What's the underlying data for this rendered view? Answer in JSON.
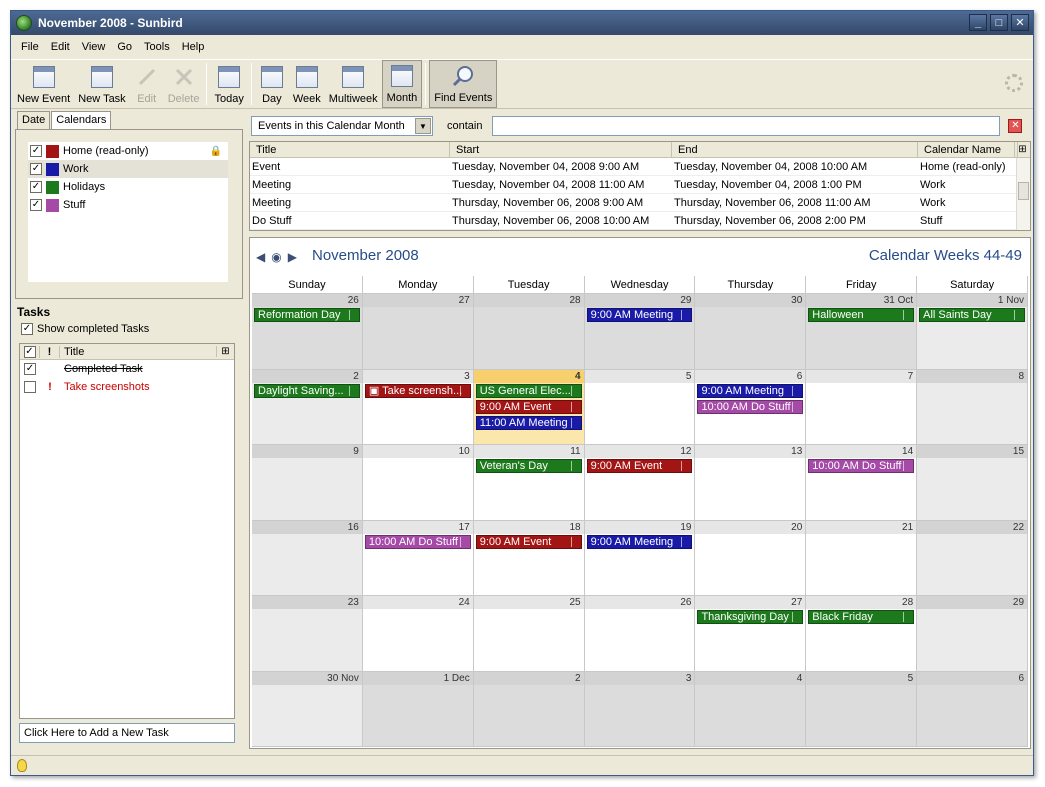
{
  "window": {
    "title": "November 2008 - Sunbird"
  },
  "menu": [
    "File",
    "Edit",
    "View",
    "Go",
    "Tools",
    "Help"
  ],
  "toolbar": {
    "new_event": "New Event",
    "new_task": "New Task",
    "edit": "Edit",
    "delete": "Delete",
    "today": "Today",
    "day": "Day",
    "week": "Week",
    "multiweek": "Multiweek",
    "month": "Month",
    "find_events": "Find Events"
  },
  "left": {
    "tabs": [
      "Date",
      "Calendars"
    ],
    "calendars": [
      {
        "name": "Home (read-only)",
        "color": "#a31414",
        "locked": true
      },
      {
        "name": "Work",
        "color": "#1a1aa8"
      },
      {
        "name": "Holidays",
        "color": "#1c7a1c"
      },
      {
        "name": "Stuff",
        "color": "#a64aa8"
      }
    ],
    "tasks_header": "Tasks",
    "show_completed": "Show completed Tasks",
    "task_col_title": "Title",
    "task_col_priority": "!",
    "tasks": [
      {
        "title": "Completed Task",
        "done": true
      },
      {
        "title": "Take screenshots",
        "done": false,
        "priority": "!"
      }
    ],
    "add_task": "Click Here to Add a New Task"
  },
  "search": {
    "filter": "Events in this Calendar Month",
    "contain": "contain",
    "query": ""
  },
  "event_list": {
    "columns": [
      "Title",
      "Start",
      "End",
      "Calendar Name"
    ],
    "rows": [
      [
        "Event",
        "Tuesday, November 04, 2008 9:00 AM",
        "Tuesday, November 04, 2008 10:00 AM",
        "Home (read-only)"
      ],
      [
        "Meeting",
        "Tuesday, November 04, 2008 11:00 AM",
        "Tuesday, November 04, 2008 1:00 PM",
        "Work"
      ],
      [
        "Meeting",
        "Thursday, November 06, 2008 9:00 AM",
        "Thursday, November 06, 2008 11:00 AM",
        "Work"
      ],
      [
        "Do Stuff",
        "Thursday, November 06, 2008 10:00 AM",
        "Thursday, November 06, 2008 2:00 PM",
        "Stuff"
      ]
    ]
  },
  "month": {
    "title": "November 2008",
    "weeks_label": "Calendar Weeks 44-49",
    "days": [
      "Sunday",
      "Monday",
      "Tuesday",
      "Wednesday",
      "Thursday",
      "Friday",
      "Saturday"
    ],
    "weeks": [
      [
        {
          "n": "26",
          "t": "other",
          "ev": [
            {
              "l": "Reformation Day",
              "c": "green"
            }
          ]
        },
        {
          "n": "27",
          "t": "other",
          "ev": []
        },
        {
          "n": "28",
          "t": "other",
          "ev": []
        },
        {
          "n": "29",
          "t": "other",
          "ev": [
            {
              "l": "9:00 AM Meeting",
              "c": "blue"
            }
          ]
        },
        {
          "n": "30",
          "t": "other",
          "ev": []
        },
        {
          "n": "31 Oct",
          "t": "other",
          "ev": [
            {
              "l": "Halloween",
              "c": "green"
            }
          ]
        },
        {
          "n": "1 Nov",
          "t": "wkend",
          "ev": [
            {
              "l": "All Saints Day",
              "c": "green"
            }
          ]
        }
      ],
      [
        {
          "n": "2",
          "t": "wkend",
          "ev": [
            {
              "l": "Daylight Saving...",
              "c": "green"
            }
          ]
        },
        {
          "n": "3",
          "t": "",
          "ev": [
            {
              "l": "▣ Take screensh...",
              "c": "red"
            }
          ]
        },
        {
          "n": "4",
          "t": "today",
          "ev": [
            {
              "l": "US General Elec...",
              "c": "green"
            },
            {
              "l": "9:00 AM Event",
              "c": "red"
            },
            {
              "l": "11:00 AM Meeting",
              "c": "blue"
            }
          ]
        },
        {
          "n": "5",
          "t": "",
          "ev": []
        },
        {
          "n": "6",
          "t": "",
          "ev": [
            {
              "l": "9:00 AM Meeting",
              "c": "blue"
            },
            {
              "l": "10:00 AM Do Stuff",
              "c": "purple"
            }
          ]
        },
        {
          "n": "7",
          "t": "",
          "ev": []
        },
        {
          "n": "8",
          "t": "wkend",
          "ev": []
        }
      ],
      [
        {
          "n": "9",
          "t": "wkend",
          "ev": []
        },
        {
          "n": "10",
          "t": "",
          "ev": []
        },
        {
          "n": "11",
          "t": "",
          "ev": [
            {
              "l": "Veteran's Day",
              "c": "green"
            }
          ]
        },
        {
          "n": "12",
          "t": "",
          "ev": [
            {
              "l": "9:00 AM Event",
              "c": "red"
            }
          ]
        },
        {
          "n": "13",
          "t": "",
          "ev": []
        },
        {
          "n": "14",
          "t": "",
          "ev": [
            {
              "l": "10:00 AM Do Stuff",
              "c": "purple"
            }
          ]
        },
        {
          "n": "15",
          "t": "wkend",
          "ev": []
        }
      ],
      [
        {
          "n": "16",
          "t": "wkend",
          "ev": []
        },
        {
          "n": "17",
          "t": "",
          "ev": [
            {
              "l": "10:00 AM Do Stuff",
              "c": "purple"
            }
          ]
        },
        {
          "n": "18",
          "t": "",
          "ev": [
            {
              "l": "9:00 AM Event",
              "c": "red"
            }
          ]
        },
        {
          "n": "19",
          "t": "",
          "ev": [
            {
              "l": "9:00 AM Meeting",
              "c": "blue"
            }
          ]
        },
        {
          "n": "20",
          "t": "",
          "ev": []
        },
        {
          "n": "21",
          "t": "",
          "ev": []
        },
        {
          "n": "22",
          "t": "wkend",
          "ev": []
        }
      ],
      [
        {
          "n": "23",
          "t": "wkend",
          "ev": []
        },
        {
          "n": "24",
          "t": "",
          "ev": []
        },
        {
          "n": "25",
          "t": "",
          "ev": []
        },
        {
          "n": "26",
          "t": "",
          "ev": []
        },
        {
          "n": "27",
          "t": "",
          "ev": [
            {
              "l": "Thanksgiving Day",
              "c": "green"
            }
          ]
        },
        {
          "n": "28",
          "t": "",
          "ev": [
            {
              "l": "Black Friday",
              "c": "green"
            }
          ]
        },
        {
          "n": "29",
          "t": "wkend",
          "ev": []
        }
      ],
      [
        {
          "n": "30 Nov",
          "t": "wkend",
          "ev": []
        },
        {
          "n": "1 Dec",
          "t": "other",
          "ev": []
        },
        {
          "n": "2",
          "t": "other",
          "ev": []
        },
        {
          "n": "3",
          "t": "other",
          "ev": []
        },
        {
          "n": "4",
          "t": "other",
          "ev": []
        },
        {
          "n": "5",
          "t": "other",
          "ev": []
        },
        {
          "n": "6",
          "t": "other",
          "ev": []
        }
      ]
    ]
  }
}
